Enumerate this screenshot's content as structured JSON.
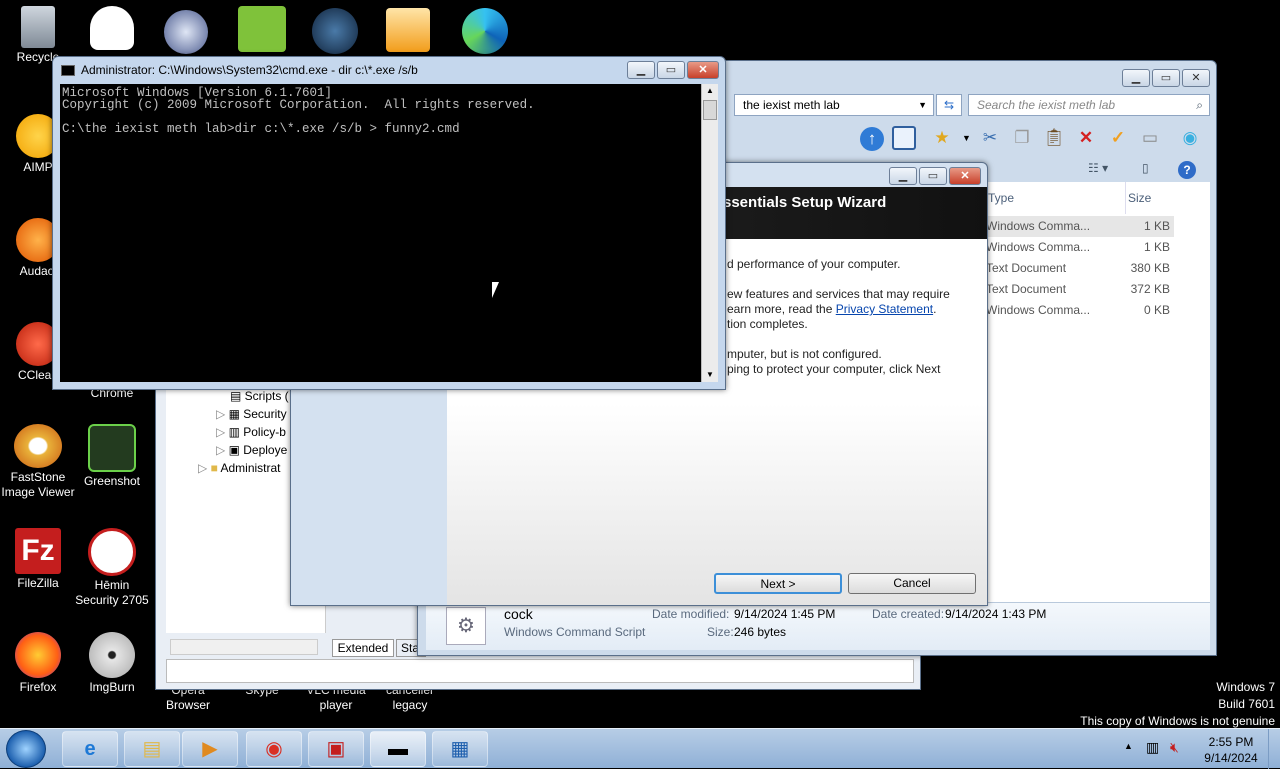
{
  "desktop_icons": [
    {
      "label": "Recycle",
      "icon": "recycle-bin-icon"
    },
    {
      "label": "AIMP",
      "icon": "aimp-icon"
    },
    {
      "label": "Audaci",
      "icon": "audacity-icon"
    },
    {
      "label": "CClean",
      "icon": "ccleaner-icon"
    },
    {
      "label": "Chrome",
      "icon": "chrome-icon"
    },
    {
      "label": "FastStone Image Viewer",
      "icon": "faststone-icon"
    },
    {
      "label": "Greenshot",
      "icon": "greenshot-icon"
    },
    {
      "label": "FileZilla",
      "icon": "filezilla-icon"
    },
    {
      "label": "Hēmin Security 2705",
      "icon": "hemin-security-icon"
    },
    {
      "label": "Firefox",
      "icon": "firefox-icon"
    },
    {
      "label": "ImgBurn",
      "icon": "imgburn-icon"
    },
    {
      "label": "Opera Browser",
      "icon": "opera-icon"
    },
    {
      "label": "Skype",
      "icon": "skype-icon"
    },
    {
      "label": "VLC media player",
      "icon": "vlc-icon"
    },
    {
      "label": "canceller legacy",
      "icon": "canceller-icon"
    }
  ],
  "cmd": {
    "title": "Administrator: C:\\Windows\\System32\\cmd.exe - dir  c:\\*.exe /s/b",
    "lines": [
      "Microsoft Windows [Version 6.1.7601]",
      "Copyright (c) 2009 Microsoft Corporation.  All rights reserved.",
      "",
      "C:\\the iexist meth lab>dir c:\\*.exe /s/b > funny2.cmd"
    ]
  },
  "explorer": {
    "address": "the iexist meth lab",
    "search_placeholder": "Search the iexist meth lab",
    "columns": {
      "type": "Type",
      "size": "Size"
    },
    "files": [
      {
        "type": "Windows Comma...",
        "size": "1 KB"
      },
      {
        "type": "Windows Comma...",
        "size": "1 KB"
      },
      {
        "type": "Text Document",
        "size": "380 KB"
      },
      {
        "type": "Text Document",
        "size": "372 KB"
      },
      {
        "type": "Windows Comma...",
        "size": "0 KB"
      }
    ],
    "details": {
      "name": "cock",
      "kind": "Windows Command Script",
      "modified_label": "Date modified:",
      "modified": "9/14/2024 1:45 PM",
      "created_label": "Date created:",
      "created": "9/14/2024 1:43 PM",
      "size_label": "Size:",
      "size": "246 bytes"
    }
  },
  "mmc": {
    "tree": [
      "Scripts (",
      "Security",
      "Policy-b",
      "Deploye",
      "Administrat"
    ],
    "tabs": [
      "Extended",
      "Sta"
    ]
  },
  "wizard": {
    "title": "ssentials Setup Wizard",
    "p1": "d performance of your computer.",
    "p2a": "ew features and services that may require",
    "p2b": "earn more, read the ",
    "privacy_link": "Privacy Statement",
    "p2b_end": ".",
    "p2c": "tion completes.",
    "p3a": "mputer, but is not configured.",
    "p3b": "ping to protect your computer, click Next",
    "next": "Next >",
    "cancel": "Cancel"
  },
  "watermark": {
    "line1": "Windows 7",
    "line2": "Build 7601",
    "line3": "This copy of Windows is not genuine"
  },
  "clock": {
    "time": "2:55 PM",
    "date": "9/14/2024"
  },
  "taskbar_items": [
    "ie-icon",
    "explorer-icon",
    "media-player-icon",
    "chrome-icon",
    "toolbox-icon",
    "cmd-icon",
    "hierarchy-icon"
  ]
}
